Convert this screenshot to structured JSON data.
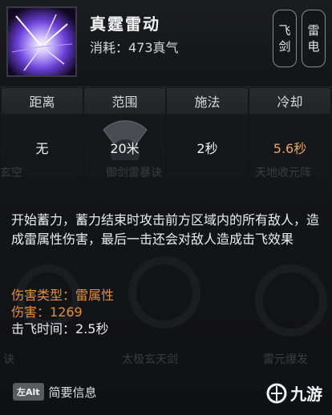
{
  "skill": {
    "name": "真霆雷动",
    "cost": "消耗：473真气"
  },
  "tags": [
    [
      "飞",
      "剑"
    ],
    [
      "雷",
      "电"
    ]
  ],
  "stats": {
    "headers": [
      "距离",
      "范围",
      "施法",
      "冷却"
    ],
    "values": [
      "无",
      "20米",
      "2秒",
      "5.6秒"
    ]
  },
  "background_faint": [
    "玄空",
    "御剑雷暴诀",
    "天地收元阵",
    "诀",
    "太极玄天剑",
    "雷元爆发"
  ],
  "description": "开始蓄力，蓄力结束时攻击前方区域内的所有敌人，造成雷属性伤害，最后一击还会对敌人造成击飞效果",
  "properties": {
    "damage_type_label": "伤害类型：",
    "damage_type_value": "雷属性",
    "damage_label": "伤害：",
    "damage_value": "1269",
    "knockup": "击飞时间：2.5秒"
  },
  "footer": {
    "key": "左Alt",
    "label": "简要信息"
  },
  "logo": {
    "text": "九游"
  },
  "colors": {
    "accent": "#e0903e",
    "cooldown": "#e8a467"
  }
}
